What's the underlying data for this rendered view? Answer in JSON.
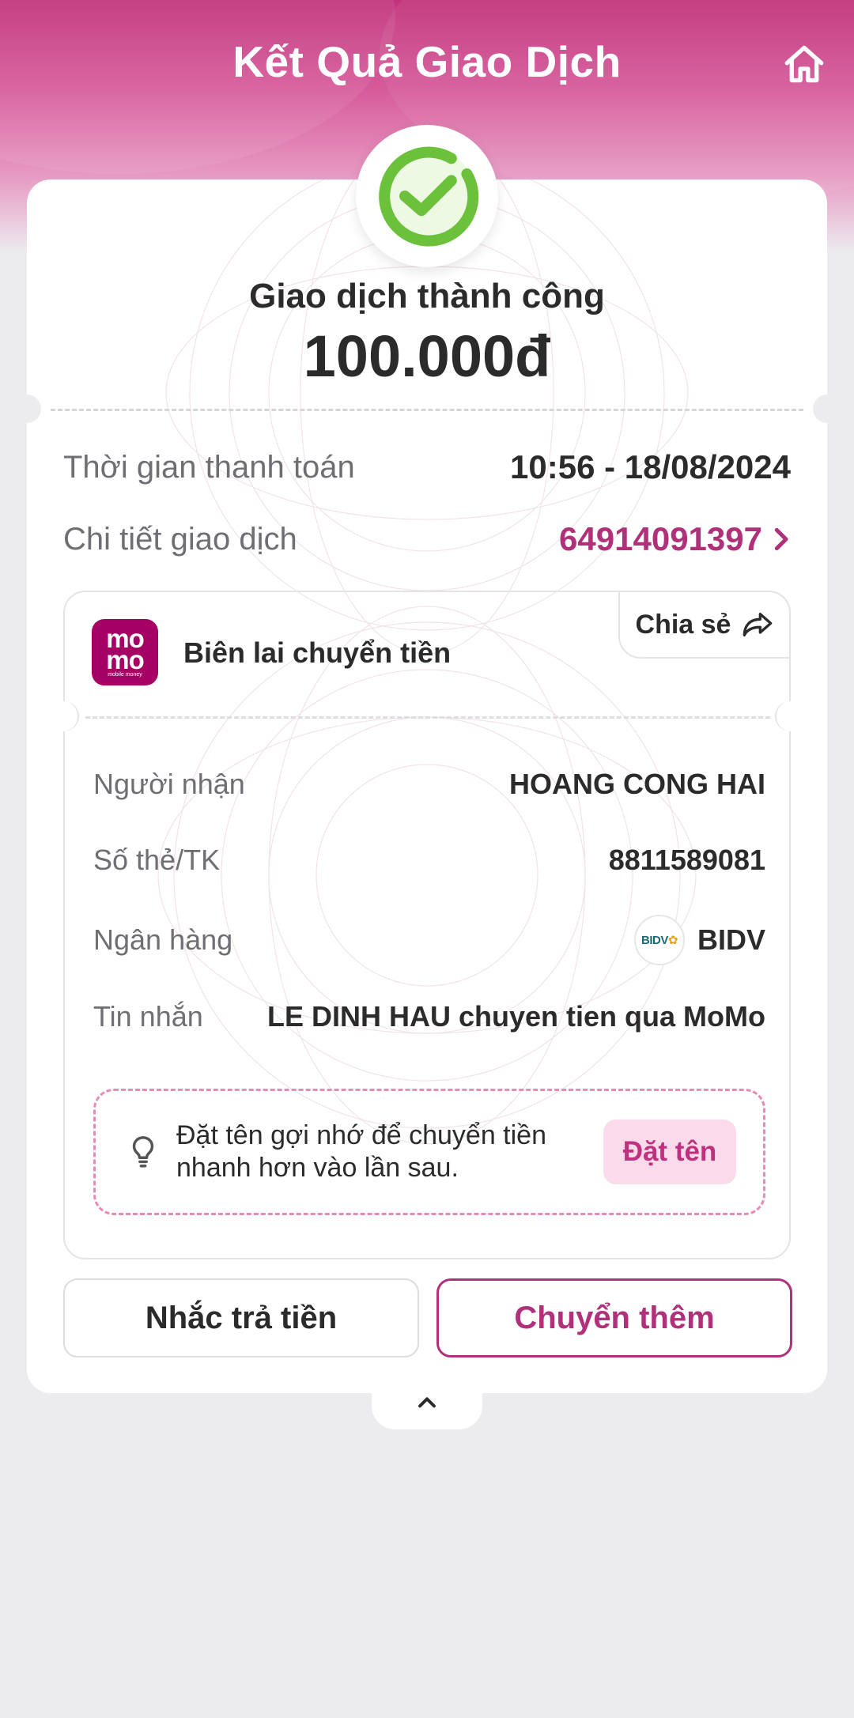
{
  "header": {
    "title": "Kết Quả Giao Dịch",
    "home_icon": "home-icon"
  },
  "result": {
    "status": "Giao dịch thành công",
    "amount": "100.000đ",
    "success_icon": "check-circle-icon"
  },
  "summary": {
    "time_label": "Thời gian thanh toán",
    "time_value": "10:56 - 18/08/2024",
    "detail_label": "Chi tiết giao dịch",
    "detail_value": "64914091397"
  },
  "receipt": {
    "logo_text": "mo mo",
    "title": "Biên lai chuyển tiền",
    "share_label": "Chia sẻ",
    "rows": [
      {
        "label": "Người nhận",
        "value": "HOANG CONG HAI"
      },
      {
        "label": "Số thẻ/TK",
        "value": "8811589081"
      },
      {
        "label": "Ngân hàng",
        "value": "BIDV"
      },
      {
        "label": "Tin nhắn",
        "value": "LE DINH HAU chuyen tien qua MoMo"
      }
    ],
    "hint_text": "Đặt tên gợi nhớ để chuyển tiền nhanh hơn vào lần sau.",
    "hint_button": "Đặt tên"
  },
  "actions": {
    "remind_label": "Nhắc trả tiền",
    "transfer_more_label": "Chuyển thêm"
  },
  "colors": {
    "brand": "#b0307a",
    "success": "#6cc13a",
    "header_gradient_top": "#c2337c"
  }
}
